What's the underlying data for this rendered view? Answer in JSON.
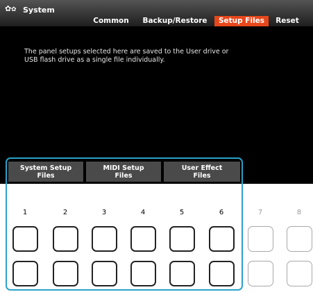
{
  "header": {
    "app_title": "System",
    "gear_icon": "gears-icon",
    "tabs": [
      {
        "label": "Common",
        "active": false
      },
      {
        "label": "Backup/Restore",
        "active": false
      },
      {
        "label": "Setup Files",
        "active": true
      },
      {
        "label": "Reset",
        "active": false
      }
    ],
    "active_tab_color": "#e8471c"
  },
  "description": "The panel setups selected here are saved to the User drive or\nUSB flash drive as a single file individually.",
  "column_buttons": [
    {
      "label": "System Setup\nFiles"
    },
    {
      "label": "MIDI Setup\nFiles"
    },
    {
      "label": "User Effect\nFiles"
    }
  ],
  "highlight_color": "#2aa2c9",
  "columns": [
    {
      "number": "1",
      "enabled": true
    },
    {
      "number": "2",
      "enabled": true
    },
    {
      "number": "3",
      "enabled": true
    },
    {
      "number": "4",
      "enabled": true
    },
    {
      "number": "5",
      "enabled": true
    },
    {
      "number": "6",
      "enabled": true
    },
    {
      "number": "7",
      "enabled": false
    },
    {
      "number": "8",
      "enabled": false
    }
  ]
}
